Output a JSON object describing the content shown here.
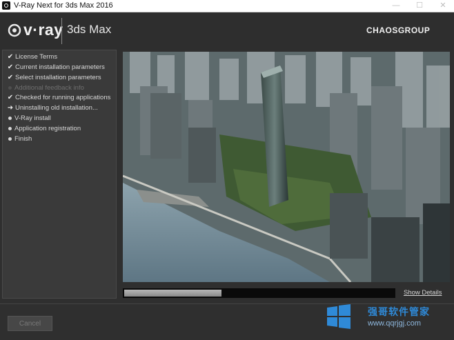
{
  "window": {
    "title": "V-Ray Next for 3ds Max 2016",
    "controls": {
      "minimize": "—",
      "maximize": "☐",
      "close": "✕"
    }
  },
  "header": {
    "brand": "v·ray",
    "product": "3ds Max",
    "vendor": "CHAOSGROUP"
  },
  "steps": [
    {
      "label": "License Terms",
      "state": "done"
    },
    {
      "label": "Current installation parameters",
      "state": "done"
    },
    {
      "label": "Select installation parameters",
      "state": "done"
    },
    {
      "label": "Additional feedback info",
      "state": "disabled"
    },
    {
      "label": "Checked for running applications",
      "state": "done"
    },
    {
      "label": "Uninstalling old installation...",
      "state": "current"
    },
    {
      "label": "V-Ray install",
      "state": "pending"
    },
    {
      "label": "Application registration",
      "state": "pending"
    },
    {
      "label": "Finish",
      "state": "pending"
    }
  ],
  "progress": {
    "value": 0.36
  },
  "links": {
    "show_details": "Show Details"
  },
  "buttons": {
    "cancel": "Cancel"
  },
  "watermark": {
    "title": "强哥软件管家",
    "url": "www.qqrjgj.com"
  },
  "colors": {
    "background": "#2f2f2f",
    "panel": "#3a3a3a",
    "watermark_blue": "#2f8ad8"
  }
}
